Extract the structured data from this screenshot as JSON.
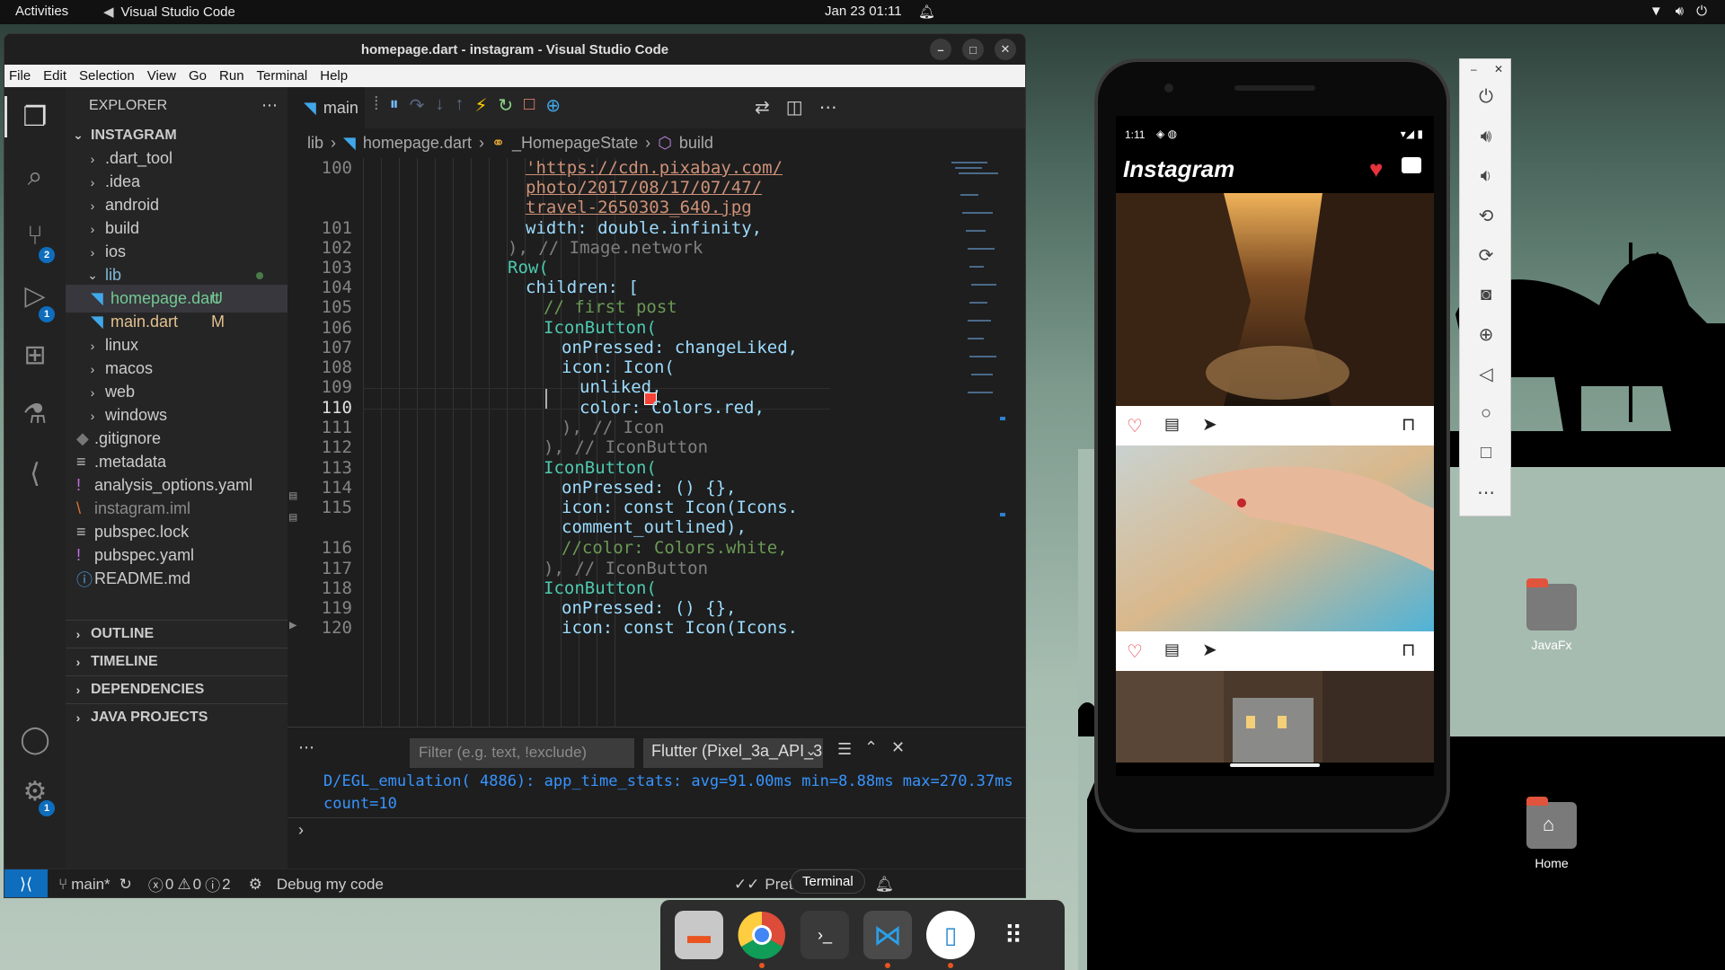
{
  "topbar": {
    "activities": "Activities",
    "app_name": "Visual Studio Code",
    "clock": "Jan 23  01:11"
  },
  "window": {
    "title": "homepage.dart - instagram - Visual Studio Code"
  },
  "menu": [
    "File",
    "Edit",
    "Selection",
    "View",
    "Go",
    "Run",
    "Terminal",
    "Help"
  ],
  "activity_badges": {
    "scm": "2",
    "debug": "1",
    "settings": "1"
  },
  "explorer": {
    "header": "EXPLORER",
    "root": "INSTAGRAM",
    "items": [
      {
        "label": ".dart_tool",
        "status": ""
      },
      {
        "label": ".idea",
        "status": ""
      },
      {
        "label": "android",
        "status": ""
      },
      {
        "label": "build",
        "status": ""
      },
      {
        "label": "ios",
        "status": ""
      },
      {
        "label": "lib",
        "status": ""
      },
      {
        "label": "homepage.dart",
        "status": "U"
      },
      {
        "label": "main.dart",
        "status": "M"
      },
      {
        "label": "linux",
        "status": ""
      },
      {
        "label": "macos",
        "status": ""
      },
      {
        "label": "web",
        "status": ""
      },
      {
        "label": "windows",
        "status": ""
      },
      {
        "label": ".gitignore",
        "status": ""
      },
      {
        "label": ".metadata",
        "status": ""
      },
      {
        "label": "analysis_options.yaml",
        "status": ""
      },
      {
        "label": "instagram.iml",
        "status": ""
      },
      {
        "label": "pubspec.lock",
        "status": ""
      },
      {
        "label": "pubspec.yaml",
        "status": ""
      },
      {
        "label": "README.md",
        "status": ""
      }
    ],
    "sections": [
      "OUTLINE",
      "TIMELINE",
      "DEPENDENCIES",
      "JAVA PROJECTS"
    ]
  },
  "editor": {
    "tab": "main",
    "breadcrumb": [
      "lib",
      "homepage.dart",
      "_HomepageState",
      "build"
    ],
    "line_numbers": [
      "100",
      "101",
      "102",
      "103",
      "104",
      "105",
      "106",
      "107",
      "108",
      "109",
      "110",
      "111",
      "112",
      "113",
      "114",
      "115",
      "116",
      "117",
      "118",
      "119",
      "120"
    ],
    "current_line": "110",
    "code": {
      "l100a": "'https://cdn.pixabay.com/",
      "l100b": "photo/2017/08/17/07/47/",
      "l100c": "travel-2650303_640.jpg",
      "l101": "width: double.infinity,",
      "l102": "), // Image.network",
      "l103": "Row(",
      "l104": "children: [",
      "l105": "// first post",
      "l106": "IconButton(",
      "l107": "onPressed: changeLiked,",
      "l108": "icon: Icon(",
      "l109": "unliked,",
      "l110": "color: Colors.red,",
      "l111": "), // Icon",
      "l112": "), // IconButton",
      "l113": "IconButton(",
      "l114": "onPressed: () {},",
      "l115a": "icon: const Icon(Icons.",
      "l115b": "comment_outlined),",
      "l116": "//color: Colors.white,",
      "l117": "), // IconButton",
      "l118": "IconButton(",
      "l119": "onPressed: () {},",
      "l120": "icon: const Icon(Icons."
    }
  },
  "panel": {
    "filter_placeholder": "Filter (e.g. text, !exclude)",
    "device_select": "Flutter (Pixel_3a_API_3",
    "output": [
      "D/EGL_emulation( 4886): app_time_stats: avg=91.00ms min=8.88ms max=270.37ms",
      "count=10"
    ]
  },
  "statusbar": {
    "branch": "main*",
    "errors": "0",
    "warnings": "0",
    "info": "2",
    "debug_label": "Debug my code",
    "prettier": "Prettier"
  },
  "tooltip": "Terminal",
  "phone": {
    "time": "1:11",
    "app_title": "Instagram"
  },
  "desktop_icons": [
    {
      "label": "JavaFx"
    },
    {
      "label": "Home"
    }
  ],
  "colors": {
    "accent": "#0e6dbd",
    "heart": "#e8323c",
    "string": "#ce9178"
  }
}
